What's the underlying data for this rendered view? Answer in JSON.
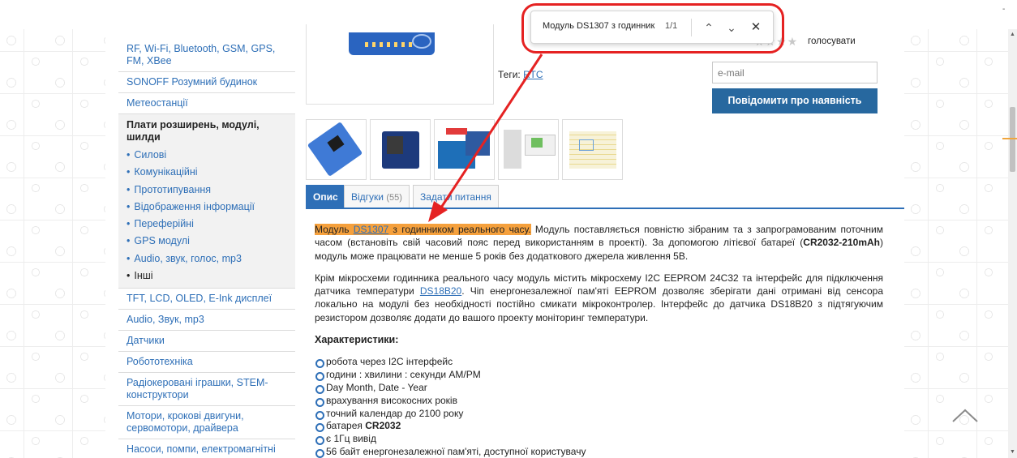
{
  "sidebar": {
    "items_top": [
      "RF, Wi-Fi, Bluetooth, GSM, GPS, FM, XBee",
      "SONOFF Розумний будинок",
      "Метеостанції"
    ],
    "group": {
      "title": "Плати розширень, модулі, шилди",
      "subitems": [
        "Силові",
        "Комунікаційні",
        "Прототипування",
        "Відображення інформації",
        "Переферійні",
        "GPS модулі",
        "Audio, звук, голос, mp3",
        "Інші"
      ]
    },
    "items_bottom": [
      "TFT, LCD, OLED, E-Ink дисплеї",
      "Audio, Звук, mp3",
      "Датчики",
      "Робототехніка",
      "Радіокеровані іграшки, STEM-конструктори",
      "Мотори, крокові двигуни, сервомотори, драйвера",
      "Насоси, помпи, електромагнітні"
    ]
  },
  "product": {
    "tags_label": "Теги:",
    "tag": "RTC",
    "vote": "голосувати",
    "email_placeholder": "e-mail",
    "notify_button": "Повідомити про наявність"
  },
  "tabs": {
    "description": "Опис",
    "reviews": "Відгуки",
    "reviews_count": "(55)",
    "question": "Задати питання"
  },
  "description": {
    "p1_hl_a": "Модуль ",
    "p1_link": "DS1307",
    "p1_hl_b": " з годинником реального часу.",
    "p1_rest_a": " Модуль поставляється повністю зібраним та з запрограмованим поточним часом (встановіть свій часовий пояс перед використанням в проекті). За допомогою літієвої батареї (",
    "p1_bold": "CR2032-210mAh",
    "p1_rest_b": ") модуль може працювати не менше 5 років без додаткового джерела живлення 5В.",
    "p2_a": "Крім мікросхеми годинника реального часу модуль містить мікросхему I2C EEPROM 24C32 та інтерфейс для підключення датчика температури ",
    "p2_link": "DS18B20",
    "p2_b": ". Чіп енергонезалежної пам'яті EEPROM дозволяє зберігати дані отримані від сенсора локально на модулі без необхідності постійно смикати мікроконтролер. Інтерфейс до датчика DS18B20 з підтягуючим резистором дозволяє додати до вашого проекту моніторинг температури.",
    "features_title": "Характеристики:",
    "features": [
      "робота через I2C інтерфейс",
      "години : хвилини : секунди AM/PM",
      "Day Month, Date - Year",
      "врахування високосних років",
      "точний календар до 2100 року",
      "батарея ",
      "є 1Гц вивід",
      "56 байт енергонезалежної пам'яті, доступної користувачу"
    ],
    "feature_battery_bold": "CR2032"
  },
  "findbar": {
    "query": "Модуль DS1307 з годинник",
    "count": "1/1"
  },
  "colors": {
    "link": "#2e6fb7",
    "highlight": "#f5a03c",
    "button": "#27689f",
    "annotation": "#e52222"
  }
}
